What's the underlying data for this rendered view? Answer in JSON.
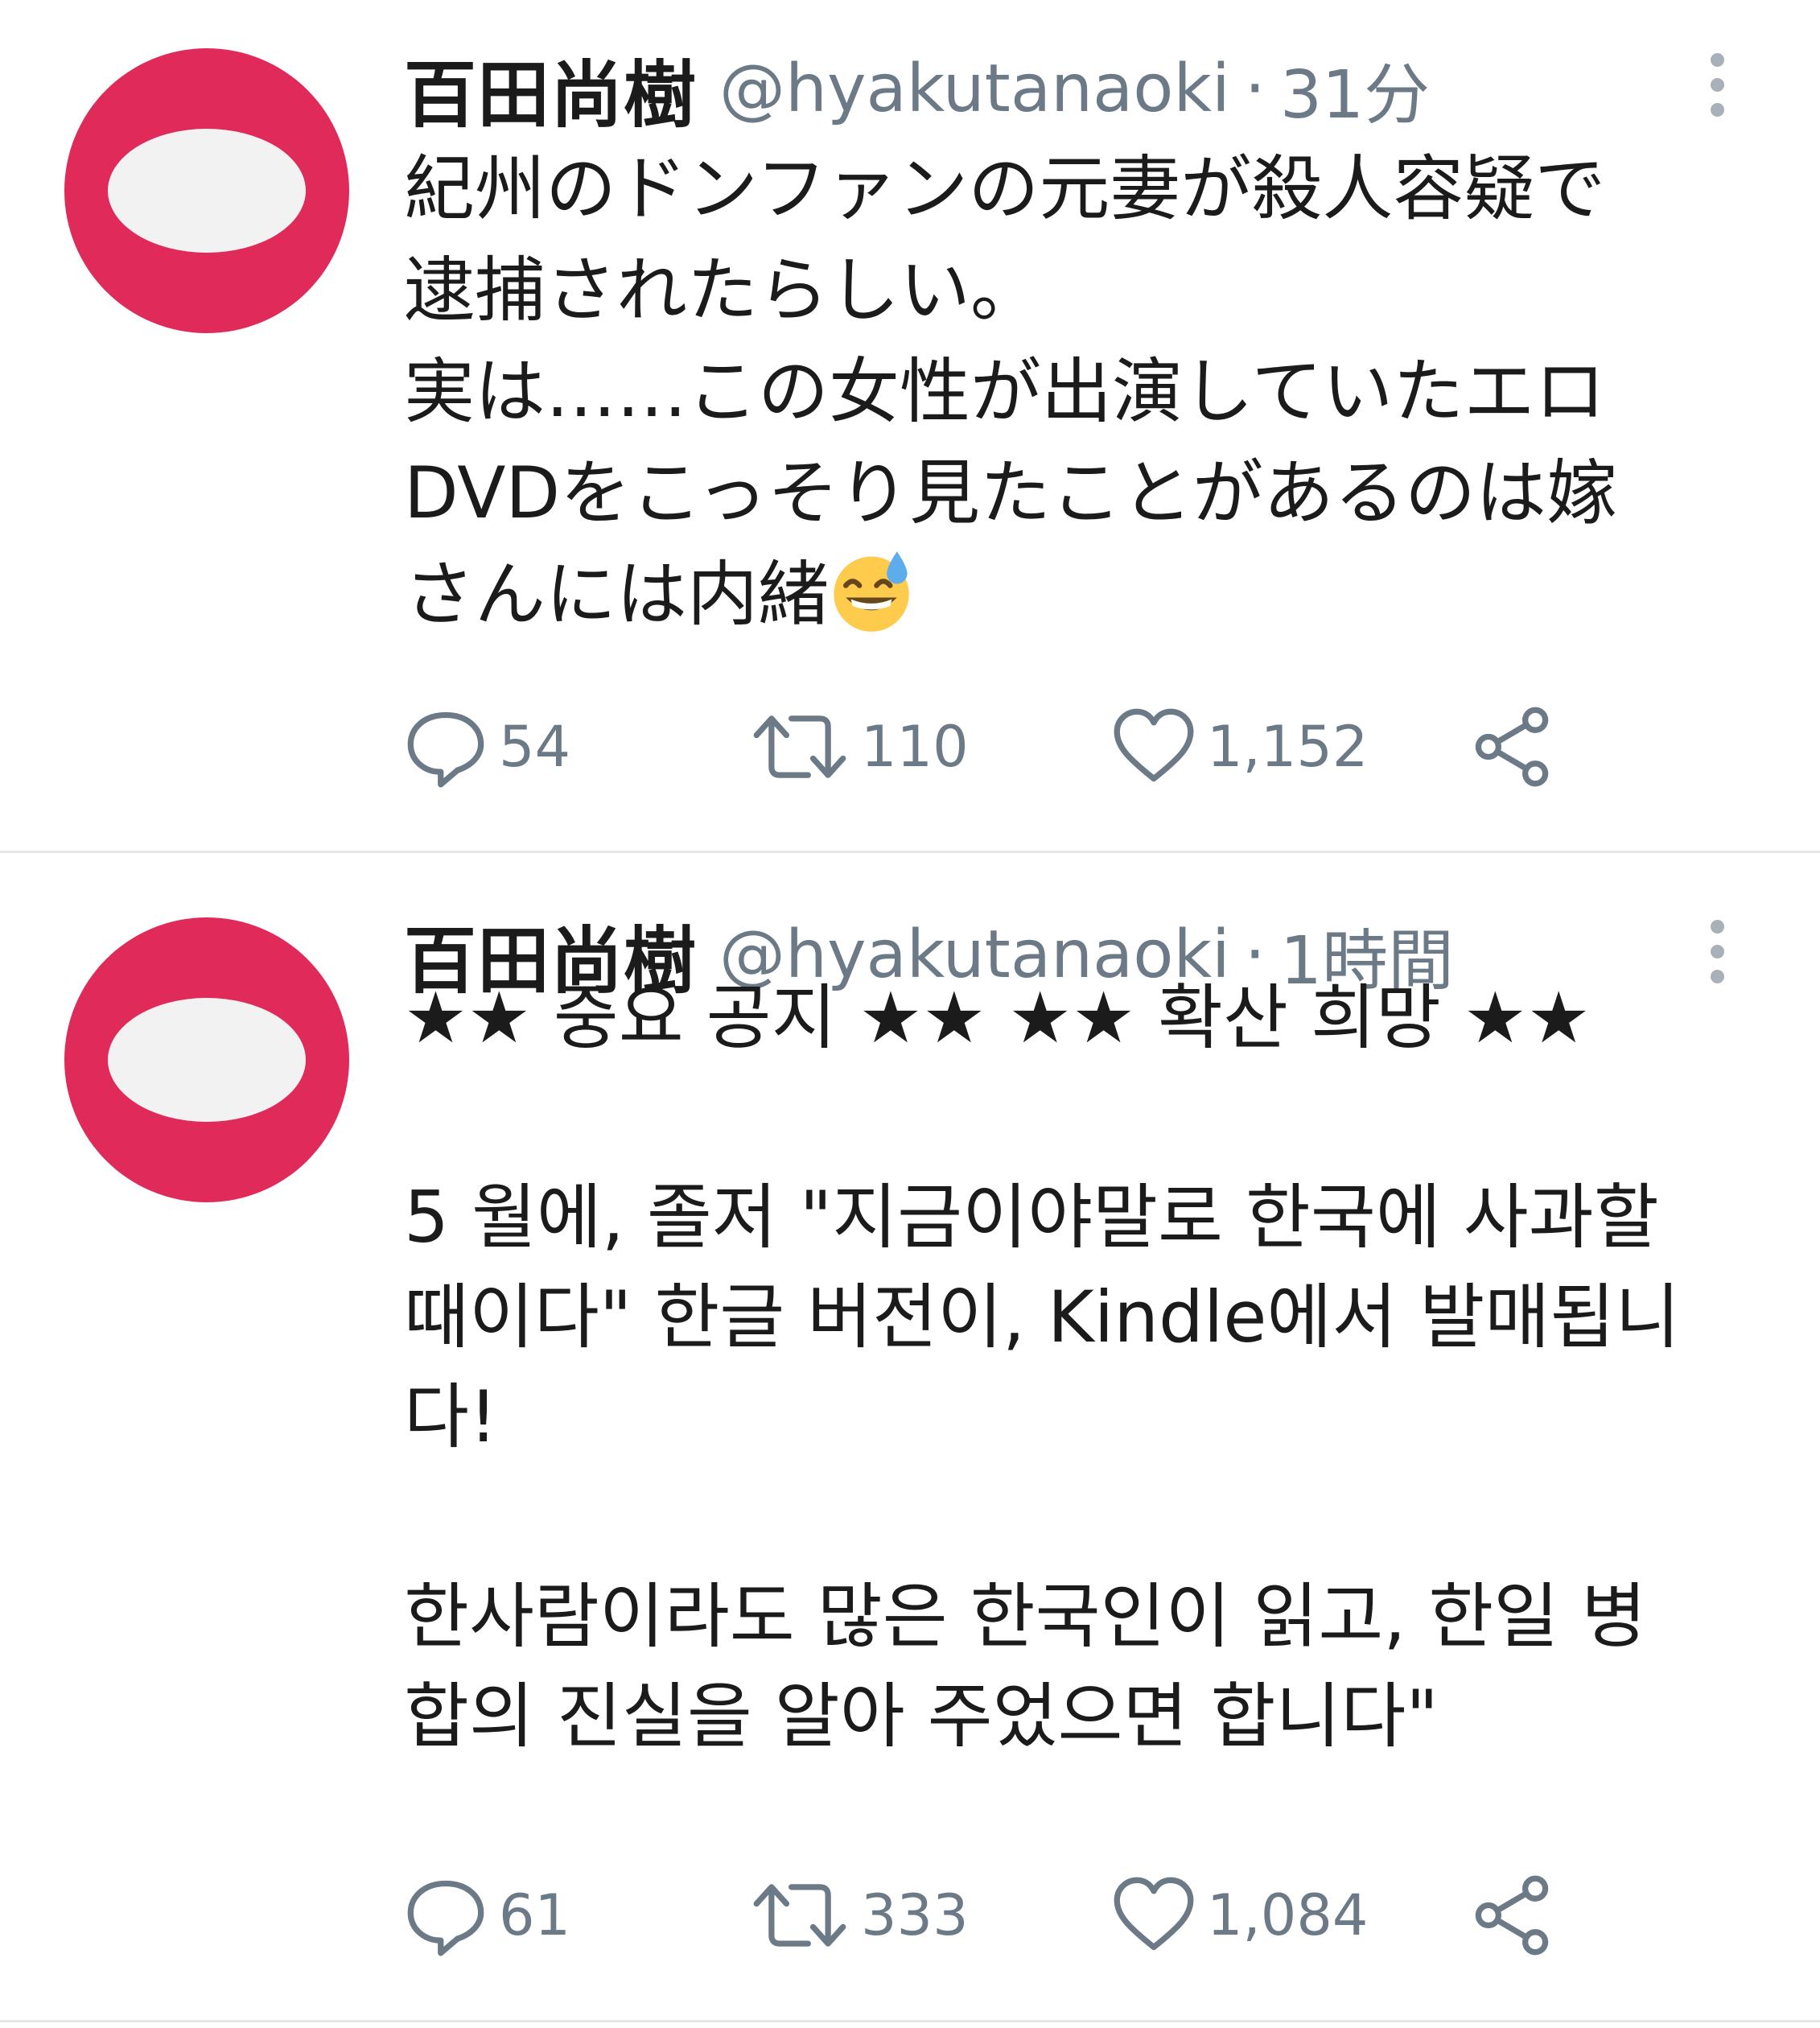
{
  "tweets": [
    {
      "author": {
        "name": "百田尚樹",
        "handle": "@hyakutanaoki",
        "separator": "·",
        "time": "31分"
      },
      "text_lines": [
        "紀州のドンファンの元妻が殺人容疑で",
        "逮捕されたらしい。",
        "実は……この女性が出演していたエロ",
        "DVDをこっそり見たことがあるのは嫁",
        "さんには内緒"
      ],
      "emoji": "grinning-face-with-sweat",
      "stats": {
        "replies": "54",
        "retweets": "110",
        "likes": "1,152"
      }
    },
    {
      "author": {
        "name": "百田尚樹",
        "handle": "@hyakutanaoki",
        "separator": "·",
        "time": "1時間"
      },
      "text_lines": [
        "★★ 중요 공지 ★★ ★★ 확산 희망 ★★",
        "",
        "5 월에, 졸저 \"지금이야말로 한국에 사과할",
        "때이다\" 한글 버전이, Kindle에서 발매됩니",
        "다!",
        "",
        "한사람이라도 많은 한국인이 읽고, 한일 병",
        "합의 진실을 알아 주었으면 합니다\""
      ],
      "stats": {
        "replies": "61",
        "retweets": "333",
        "likes": "1,084"
      }
    }
  ],
  "colors": {
    "avatar": "#df2a5a",
    "avatar_inner": "#f2f2f2",
    "muted": "#6b7a86",
    "text": "#1b1b1b",
    "divider": "#e4e7ea"
  },
  "icons": [
    "reply-icon",
    "retweet-icon",
    "like-icon",
    "share-icon",
    "more-options-icon"
  ]
}
